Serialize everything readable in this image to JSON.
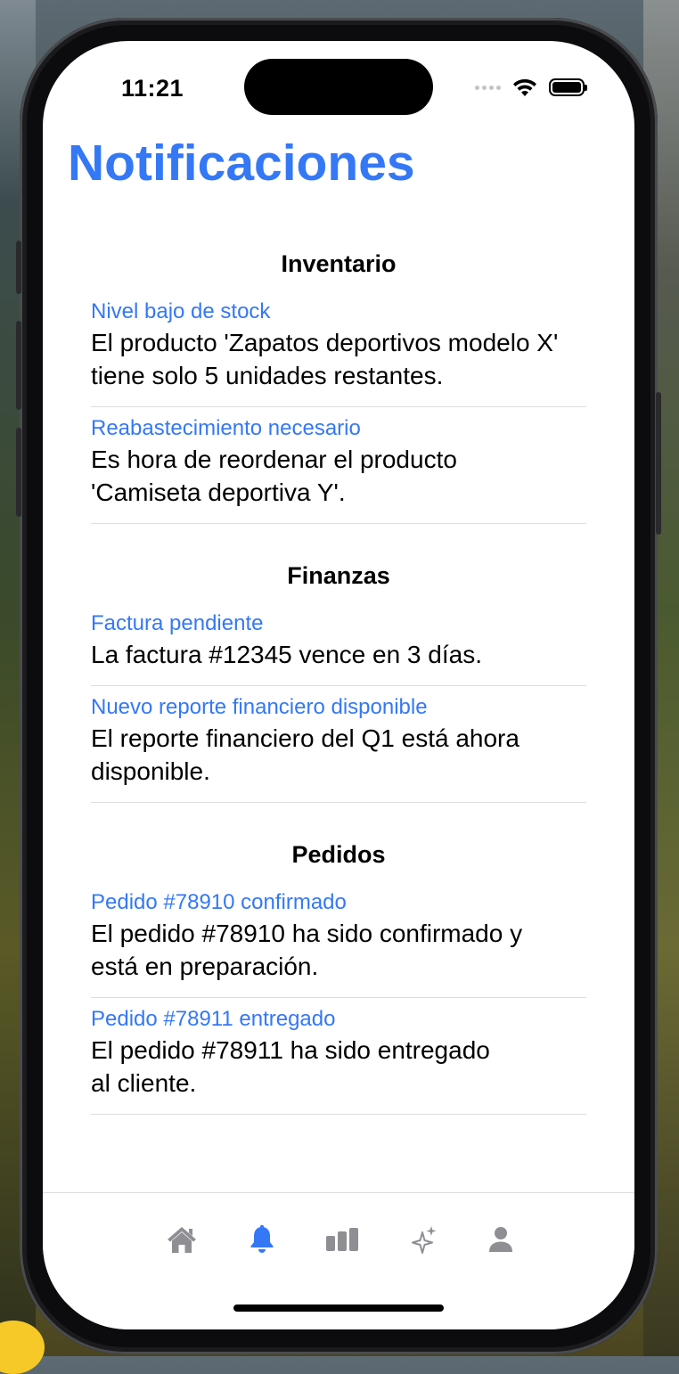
{
  "status_bar": {
    "time": "11:21"
  },
  "page": {
    "title": "Notificaciones"
  },
  "sections": [
    {
      "header": "Inventario",
      "items": [
        {
          "title": "Nivel bajo de stock",
          "body_lines": [
            "El producto 'Zapatos deportivos modelo X'",
            "tiene solo 5 unidades restantes."
          ]
        },
        {
          "title": "Reabastecimiento necesario",
          "body_lines": [
            "Es hora de reordenar el producto",
            "'Camiseta deportiva Y'."
          ]
        }
      ]
    },
    {
      "header": "Finanzas",
      "items": [
        {
          "title": "Factura pendiente",
          "body_lines": [
            "La factura #12345 vence en 3 días."
          ]
        },
        {
          "title": "Nuevo reporte financiero disponible",
          "body_lines": [
            "El reporte financiero del Q1 está ahora",
            "disponible."
          ]
        }
      ]
    },
    {
      "header": "Pedidos",
      "items": [
        {
          "title": "Pedido #78910 confirmado",
          "body_lines": [
            "El pedido #78910 ha sido confirmado y",
            "está en preparación."
          ]
        },
        {
          "title": "Pedido #78911 entregado",
          "body_lines": [
            "El pedido #78911 ha sido entregado",
            "al cliente."
          ]
        }
      ]
    }
  ],
  "tab_bar": {
    "tabs": [
      {
        "icon": "house-icon",
        "selected": false
      },
      {
        "icon": "bell-icon",
        "selected": true
      },
      {
        "icon": "bar-chart-icon",
        "selected": false
      },
      {
        "icon": "sparkles-icon",
        "selected": false
      },
      {
        "icon": "person-icon",
        "selected": false
      }
    ]
  },
  "colors": {
    "accent": "#3478f6",
    "tab_inactive": "#8e8e93",
    "divider": "#dedede"
  }
}
